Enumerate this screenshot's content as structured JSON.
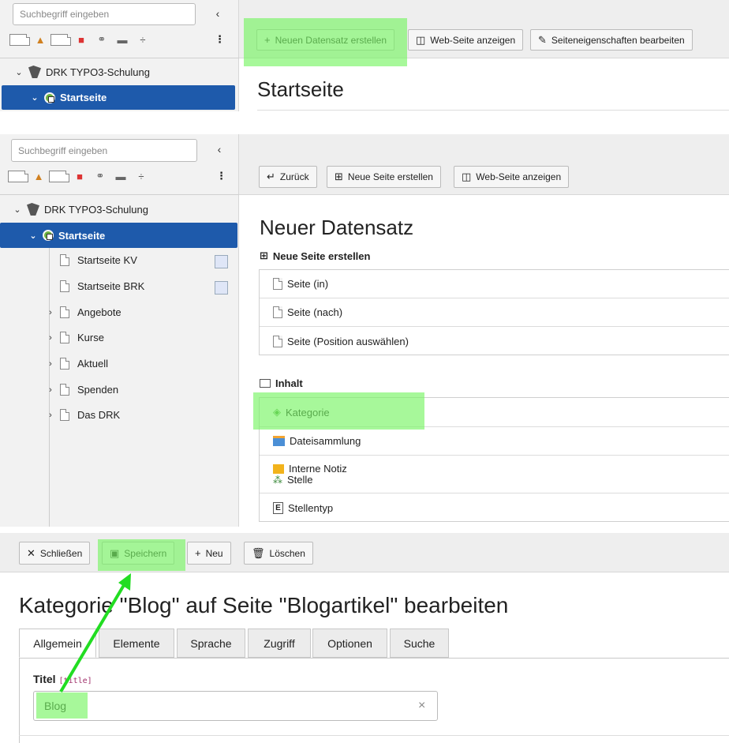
{
  "panel1": {
    "search_placeholder": "Suchbegriff eingeben",
    "tree": {
      "root": "DRK TYPO3-Schulung",
      "selected": "Startseite"
    },
    "buttons": {
      "new_record": "Neuen Datensatz erstellen",
      "view_page": "Web-Seite anzeigen",
      "edit_page_props": "Seiteneigenschaften bearbeiten"
    },
    "title": "Startseite"
  },
  "panel2": {
    "search_placeholder": "Suchbegriff eingeben",
    "tree": {
      "root": "DRK TYPO3-Schulung",
      "selected": "Startseite",
      "children": [
        "Startseite KV",
        "Startseite BRK",
        "Angebote",
        "Kurse",
        "Aktuell",
        "Spenden",
        "Das DRK"
      ]
    },
    "buttons": {
      "back": "Zurück",
      "new_page": "Neue Seite erstellen",
      "view_page": "Web-Seite anzeigen"
    },
    "title": "Neuer Datensatz",
    "new_page_section": "Neue Seite erstellen",
    "new_page_rows": [
      "Seite (in)",
      "Seite (nach)",
      "Seite (Position auswählen)"
    ],
    "content_section": "Inhalt",
    "content_rows": {
      "kategorie": "Kategorie",
      "dateisammlung": "Dateisammlung",
      "interne_notiz": "Interne Notiz",
      "stelle": "Stelle",
      "stellentyp": "Stellentyp"
    }
  },
  "panel3": {
    "buttons": {
      "close": "Schließen",
      "save": "Speichern",
      "new": "Neu",
      "delete": "Löschen"
    },
    "title": "Kategorie \"Blog\" auf Seite \"Blogartikel\" bearbeiten",
    "tabs": [
      "Allgemein",
      "Elemente",
      "Sprache",
      "Zugriff",
      "Optionen",
      "Suche"
    ],
    "field_label": "Titel",
    "field_key": "[title]",
    "field_value": "Blog",
    "clear_symbol": "×"
  },
  "colors": {
    "selection": "#1e5aab",
    "highlight": "#78f564",
    "arrow": "#22dd22"
  }
}
